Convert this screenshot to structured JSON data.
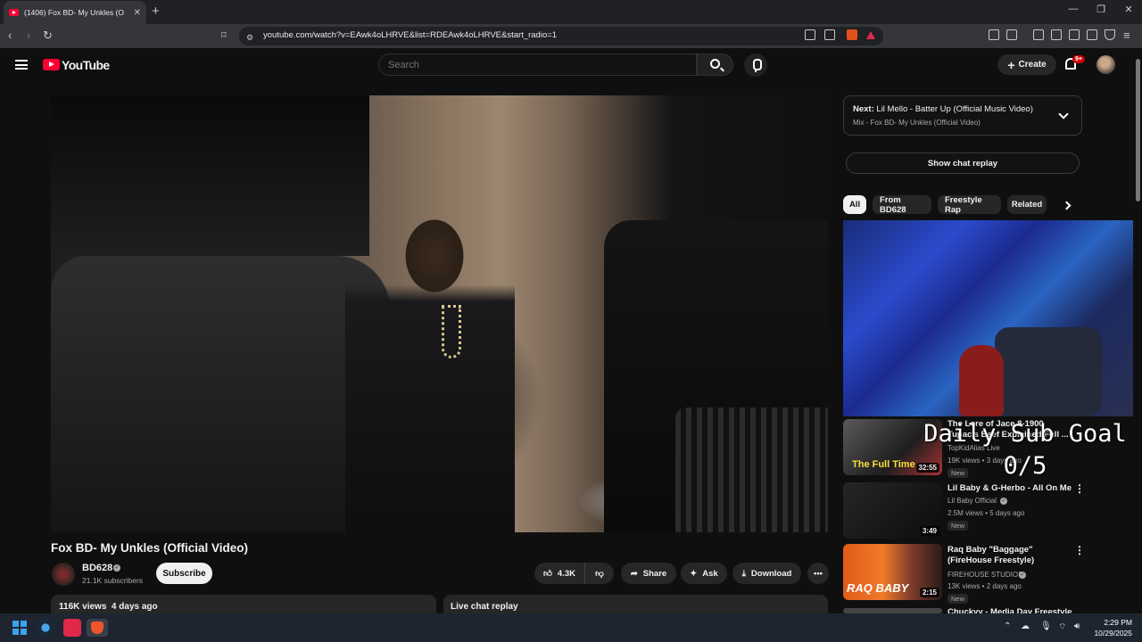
{
  "browser": {
    "tab_title": "(1406) Fox BD- My Unkles (O",
    "new_tab": "+",
    "url": "youtube.com/watch?v=EAwk4oLHRVE&list=RDEAwk4oLHRVE&start_radio=1"
  },
  "header": {
    "logo_text": "YouTube",
    "search_placeholder": "Search",
    "create_label": "Create",
    "notif_badge": "9+"
  },
  "video": {
    "title": "Fox BD- My Unkles (Official Video)",
    "channel": "BD628",
    "subscribers": "21.1K subscribers",
    "subscribe_label": "Subscribe",
    "likes": "4.3K",
    "share_label": "Share",
    "ask_label": "Ask",
    "download_label": "Download",
    "views_line": "116K views  4 days ago",
    "live_chat_label": "Live chat replay"
  },
  "sidebar": {
    "next_prefix": "Next:",
    "next_title": "Lil Mello - Batter Up (Official Music Video)",
    "next_sub": "Mix - Fox BD- My Unkles (Official Video)",
    "show_chat": "Show chat replay",
    "chips": [
      "All",
      "From BD628",
      "Freestyle Rap",
      "Related"
    ],
    "overlay_line1": "Daily Sub Goal",
    "overlay_line2": "0/5",
    "videos": [
      {
        "title": "The Lore of Jace 8-1900 Tupac's Beef Explained Full ...",
        "channel": "TopKidAlias Live",
        "meta": "19K views • 3 days ago",
        "badge": "New",
        "duration": "32:55",
        "thumb_text": "The Full Time"
      },
      {
        "title": "Lil Baby & G-Herbo - All On Me",
        "channel": "Lil Baby Official",
        "meta": "2.5M views • 5 days ago",
        "badge": "New",
        "duration": "3:49"
      },
      {
        "title": "Raq Baby \"Baggage\" (FireHouse Freestyle)",
        "channel": "FIREHOUSE STUDIOS",
        "meta": "13K views • 2 days ago",
        "badge": "New",
        "duration": "2:15",
        "thumb_text": "RAQ BABY"
      },
      {
        "title": "Chuckyy - Media Day Freestyle"
      }
    ]
  },
  "taskbar": {
    "time": "2:29 PM",
    "date": "10/29/2025"
  },
  "colors": {
    "accent_red": "#ff0033",
    "background": "#0f0f0f",
    "chip_bg": "#272727"
  }
}
